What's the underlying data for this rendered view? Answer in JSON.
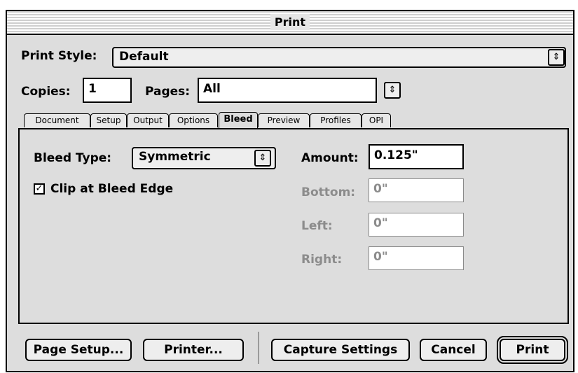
{
  "window": {
    "title": "Print"
  },
  "print_style": {
    "label": "Print Style:",
    "value": "Default"
  },
  "copies": {
    "label": "Copies:",
    "value": "1"
  },
  "pages": {
    "label": "Pages:",
    "value": "All"
  },
  "tabs": [
    {
      "label": "Document"
    },
    {
      "label": "Setup"
    },
    {
      "label": "Output"
    },
    {
      "label": "Options"
    },
    {
      "label": "Bleed"
    },
    {
      "label": "Preview"
    },
    {
      "label": "Profiles"
    },
    {
      "label": "OPI"
    }
  ],
  "active_tab": "Bleed",
  "bleed": {
    "type_label": "Bleed Type:",
    "type_value": "Symmetric",
    "clip_label": "Clip at Bleed Edge",
    "clip_checked": true,
    "amount_label": "Amount:",
    "amount_value": "0.125\"",
    "bottom_label": "Bottom:",
    "bottom_value": "0\"",
    "left_label": "Left:",
    "left_value": "0\"",
    "right_label": "Right:",
    "right_value": "0\""
  },
  "buttons": {
    "page_setup": "Page Setup...",
    "printer": "Printer...",
    "capture": "Capture Settings",
    "cancel": "Cancel",
    "print": "Print"
  },
  "icons": {
    "updown": "⇕",
    "check": "☑"
  }
}
